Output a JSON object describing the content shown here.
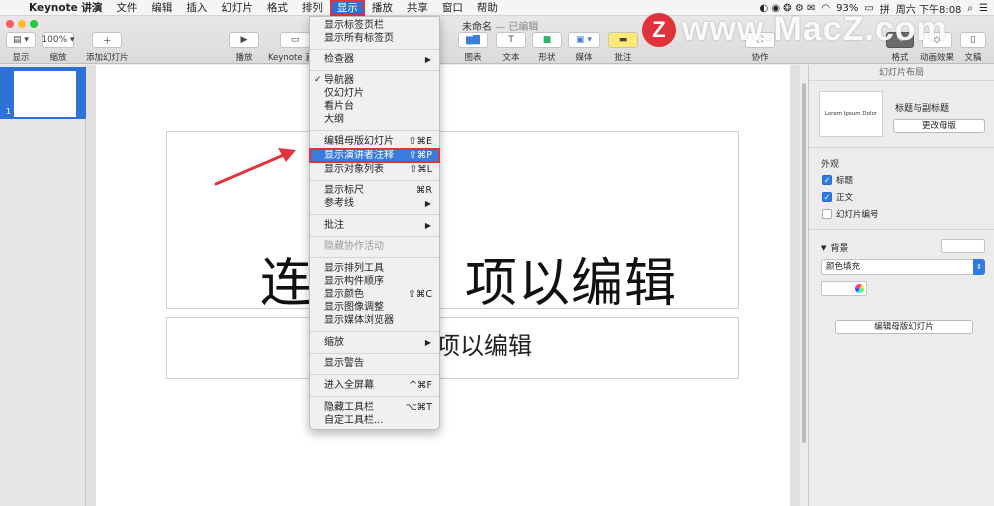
{
  "menubar": {
    "app": "Keynote 讲演",
    "items": [
      "文件",
      "编辑",
      "插入",
      "幻灯片",
      "格式",
      "排列",
      "显示",
      "播放",
      "共享",
      "窗口",
      "帮助"
    ],
    "battery": "93%",
    "ime": "拼",
    "clock": "周六 下午8:08"
  },
  "document": {
    "title": "未命名",
    "status": "— 已编辑"
  },
  "toolbar": {
    "view": "显示",
    "zoom_value": "100%",
    "zoom": "缩放",
    "add_slide": "添加幻灯片",
    "play": "播放",
    "keynote_live": "Keynote 直播",
    "chart": "图表",
    "text": "文本",
    "shape": "形状",
    "media": "媒体",
    "comment": "批注",
    "collaborate": "协作",
    "format": "格式",
    "animate": "动画效果",
    "document": "文稿"
  },
  "navigator": {
    "slide_number": "1"
  },
  "slide": {
    "title": "连按两次以编辑",
    "title_visible": "连",
    "title_visible_2": "项以编辑",
    "subtitle": "项以编辑"
  },
  "inspector": {
    "header": "幻灯片布局",
    "thumb_text": "Lorem Ipsum Dolor",
    "layout_name": "标题与副标题",
    "change_master": "更改母版",
    "appearance": "外观",
    "chk_title": "标题",
    "chk_body": "正文",
    "chk_slide_number": "幻灯片编号",
    "background": "背景",
    "fill": "颜色填充",
    "edit_master": "编辑母版幻灯片"
  },
  "view_menu": {
    "show_tab_bar": "显示标签页栏",
    "show_all_tabs": "显示所有标签页",
    "inspector": "检查器",
    "navigator": "导航器",
    "slide_only": "仅幻灯片",
    "light_table": "看片台",
    "outline": "大纲",
    "edit_master": "编辑母版幻灯片",
    "edit_master_sc": "⇧⌘E",
    "show_presenter_notes": "显示演讲者注释",
    "show_presenter_notes_sc": "⇧⌘P",
    "show_object_list": "显示对象列表",
    "show_object_list_sc": "⇧⌘L",
    "show_rulers": "显示标尺",
    "show_rulers_sc": "⌘R",
    "guides": "参考线",
    "comments": "批注",
    "hide_collab": "隐藏协作活动",
    "show_arrange": "显示排列工具",
    "show_build_order": "显示构件顺序",
    "show_colors": "显示颜色",
    "show_colors_sc": "⇧⌘C",
    "show_image_adjust": "显示图像调整",
    "show_media_browser": "显示媒体浏览器",
    "zoom": "缩放",
    "show_warnings": "显示警告",
    "enter_fullscreen": "进入全屏幕",
    "enter_fullscreen_sc": "^⌘F",
    "hide_toolbar": "隐藏工具栏",
    "hide_toolbar_sc": "⌥⌘T",
    "customize_toolbar": "自定工具栏..."
  },
  "watermark": {
    "logo": "Z",
    "text": "www.MacZ.com"
  },
  "colors": {
    "accent": "#2f72d6",
    "highlight_border": "#e0343f",
    "arrow": "#e0343f"
  }
}
